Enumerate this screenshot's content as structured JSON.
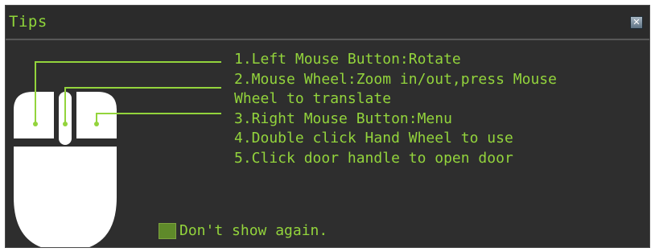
{
  "dialog": {
    "title": "Tips",
    "close_icon": "close-icon",
    "tips": [
      "1.Left Mouse Button:Rotate",
      "2.Mouse Wheel:Zoom in/out,press Mouse",
      "Wheel to translate",
      "3.Right Mouse Button:Menu",
      "4.Double click Hand Wheel to use",
      "5.Click door handle to open door"
    ],
    "dont_show_label": "Don't show again.",
    "dont_show_checked": false
  },
  "colors": {
    "background": "#2e2e2e",
    "text": "#93d43c",
    "mouse": "#ffffff",
    "checkbox": "#5f8a2a"
  }
}
